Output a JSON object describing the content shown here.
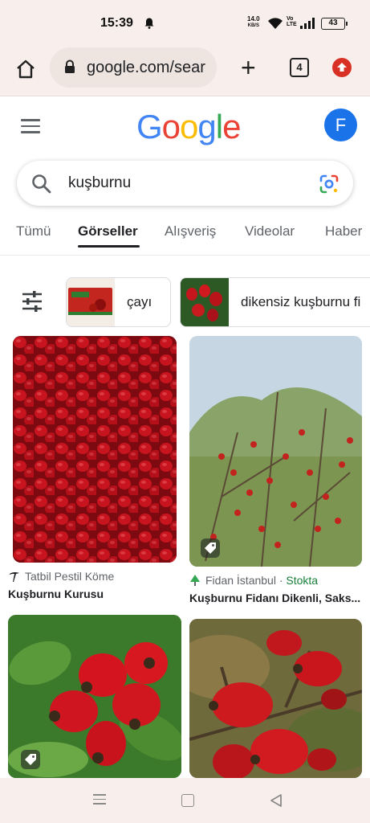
{
  "status_bar": {
    "time": "15:39",
    "net_speed_value": "14.0",
    "net_speed_unit": "KB/S",
    "volte_1": "Vo",
    "volte_2": "LTE",
    "battery": "43"
  },
  "browser": {
    "url": "google.com/sear",
    "tab_count": "4"
  },
  "google": {
    "logo_letters": [
      "G",
      "o",
      "o",
      "g",
      "l",
      "e"
    ],
    "logo_colors": [
      "#4285F4",
      "#EA4335",
      "#FBBC05",
      "#4285F4",
      "#34A853",
      "#EA4335"
    ],
    "avatar_initial": "F",
    "search_query": "kuşburnu"
  },
  "tabs": [
    {
      "label": "Tümü",
      "active": false
    },
    {
      "label": "Görseller",
      "active": true
    },
    {
      "label": "Alışveriş",
      "active": false
    },
    {
      "label": "Videolar",
      "active": false
    },
    {
      "label": "Haber",
      "active": false
    }
  ],
  "chips": [
    {
      "label": "çayı"
    },
    {
      "label": "dikensiz kuşburnu fi"
    }
  ],
  "results": [
    {
      "source": "Tatbil Pestil Köme",
      "title": "Kuşburnu Kurusu",
      "stock": ""
    },
    {
      "source": "Fidan İstanbul",
      "stock": "Stokta",
      "separator": "·",
      "title": "Kuşburnu Fidanı Dikenli, Saks..."
    }
  ],
  "colors": {
    "accent": "#1a73e8",
    "chrome_bg": "#f8efec",
    "update_badge": "#d93025",
    "stock_green": "#188038"
  }
}
